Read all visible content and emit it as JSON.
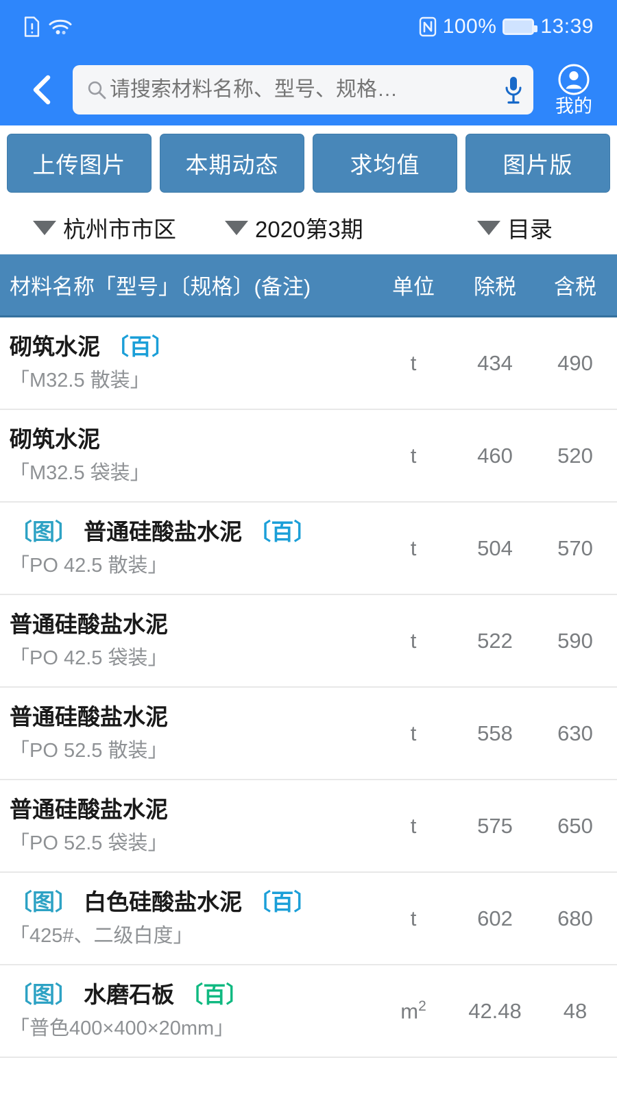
{
  "statusbar": {
    "icons": [
      "sim-alert-icon",
      "wifi-icon",
      "nfc-icon"
    ],
    "battery_text": "100%",
    "time": "13:39"
  },
  "navbar": {
    "back_label": "back-chevron",
    "search_placeholder": "请搜索材料名称、型号、规格…",
    "search_value": "",
    "mic_label": "mic-icon",
    "mine_label": "我的"
  },
  "actions": [
    {
      "label": "上传图片"
    },
    {
      "label": "本期动态"
    },
    {
      "label": "求均值"
    },
    {
      "label": "图片版"
    }
  ],
  "filters": [
    {
      "label": "杭州市市区"
    },
    {
      "label": "2020第3期"
    },
    {
      "label": "目录"
    }
  ],
  "table": {
    "headers": {
      "name": "材料名称「型号」〔规格〕(备注)",
      "unit": "单位",
      "extax": "除税",
      "intax": "含税"
    },
    "rows": [
      {
        "img_tag": "",
        "name": "砌筑水泥",
        "bai_tag": "〔百〕",
        "bai_color": "blue",
        "spec": "「M32.5 散装」",
        "unit": "t",
        "extax": "434",
        "intax": "490"
      },
      {
        "img_tag": "",
        "name": "砌筑水泥",
        "bai_tag": "",
        "bai_color": "blue",
        "spec": "「M32.5 袋装」",
        "unit": "t",
        "extax": "460",
        "intax": "520"
      },
      {
        "img_tag": "〔图〕",
        "name": "普通硅酸盐水泥",
        "bai_tag": "〔百〕",
        "bai_color": "blue",
        "spec": "「PO 42.5 散装」",
        "unit": "t",
        "extax": "504",
        "intax": "570"
      },
      {
        "img_tag": "",
        "name": "普通硅酸盐水泥",
        "bai_tag": "",
        "bai_color": "blue",
        "spec": "「PO 42.5 袋装」",
        "unit": "t",
        "extax": "522",
        "intax": "590"
      },
      {
        "img_tag": "",
        "name": "普通硅酸盐水泥",
        "bai_tag": "",
        "bai_color": "blue",
        "spec": "「PO 52.5 散装」",
        "unit": "t",
        "extax": "558",
        "intax": "630"
      },
      {
        "img_tag": "",
        "name": "普通硅酸盐水泥",
        "bai_tag": "",
        "bai_color": "blue",
        "spec": "「PO 52.5 袋装」",
        "unit": "t",
        "extax": "575",
        "intax": "650"
      },
      {
        "img_tag": "〔图〕",
        "name": "白色硅酸盐水泥",
        "bai_tag": "〔百〕",
        "bai_color": "blue",
        "spec": "「425#、二级白度」",
        "unit": "t",
        "extax": "602",
        "intax": "680"
      },
      {
        "img_tag": "〔图〕",
        "name": "水磨石板",
        "bai_tag": "〔百〕",
        "bai_color": "green",
        "spec": "「普色400×400×20mm」",
        "unit": "m²",
        "extax": "42.48",
        "intax": "48"
      }
    ]
  },
  "colors": {
    "brand_blue": "#2e86fb",
    "table_header_blue": "#4887b9",
    "tag_blue": "#1b9fd8",
    "tag_green": "#10b981"
  }
}
